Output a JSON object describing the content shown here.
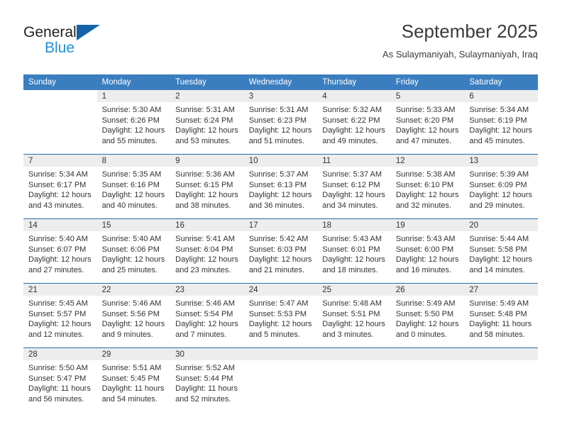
{
  "brand": {
    "line1": "General",
    "line2": "Blue",
    "triangle_color": "#1463a8",
    "blue_text_color": "#1f8fd6"
  },
  "header": {
    "title": "September 2025",
    "subtitle": "As Sulaymaniyah, Sulaymaniyah, Iraq"
  },
  "colors": {
    "header_row_bg": "#3a7ebf",
    "day_band_bg": "#ededed",
    "row_divider": "#2a6ca8",
    "text": "#333333"
  },
  "weekdays": [
    "Sunday",
    "Monday",
    "Tuesday",
    "Wednesday",
    "Thursday",
    "Friday",
    "Saturday"
  ],
  "labels": {
    "sunrise_prefix": "Sunrise:",
    "sunset_prefix": "Sunset:",
    "daylight_prefix": "Daylight:"
  },
  "weeks": [
    [
      {
        "day": "",
        "blank": true,
        "l1": "",
        "l2": "",
        "l3": "",
        "l4": ""
      },
      {
        "day": "1",
        "l1": "Sunrise: 5:30 AM",
        "l2": "Sunset: 6:26 PM",
        "l3": "Daylight: 12 hours",
        "l4": "and 55 minutes."
      },
      {
        "day": "2",
        "l1": "Sunrise: 5:31 AM",
        "l2": "Sunset: 6:24 PM",
        "l3": "Daylight: 12 hours",
        "l4": "and 53 minutes."
      },
      {
        "day": "3",
        "l1": "Sunrise: 5:31 AM",
        "l2": "Sunset: 6:23 PM",
        "l3": "Daylight: 12 hours",
        "l4": "and 51 minutes."
      },
      {
        "day": "4",
        "l1": "Sunrise: 5:32 AM",
        "l2": "Sunset: 6:22 PM",
        "l3": "Daylight: 12 hours",
        "l4": "and 49 minutes."
      },
      {
        "day": "5",
        "l1": "Sunrise: 5:33 AM",
        "l2": "Sunset: 6:20 PM",
        "l3": "Daylight: 12 hours",
        "l4": "and 47 minutes."
      },
      {
        "day": "6",
        "l1": "Sunrise: 5:34 AM",
        "l2": "Sunset: 6:19 PM",
        "l3": "Daylight: 12 hours",
        "l4": "and 45 minutes."
      }
    ],
    [
      {
        "day": "7",
        "l1": "Sunrise: 5:34 AM",
        "l2": "Sunset: 6:17 PM",
        "l3": "Daylight: 12 hours",
        "l4": "and 43 minutes."
      },
      {
        "day": "8",
        "l1": "Sunrise: 5:35 AM",
        "l2": "Sunset: 6:16 PM",
        "l3": "Daylight: 12 hours",
        "l4": "and 40 minutes."
      },
      {
        "day": "9",
        "l1": "Sunrise: 5:36 AM",
        "l2": "Sunset: 6:15 PM",
        "l3": "Daylight: 12 hours",
        "l4": "and 38 minutes."
      },
      {
        "day": "10",
        "l1": "Sunrise: 5:37 AM",
        "l2": "Sunset: 6:13 PM",
        "l3": "Daylight: 12 hours",
        "l4": "and 36 minutes."
      },
      {
        "day": "11",
        "l1": "Sunrise: 5:37 AM",
        "l2": "Sunset: 6:12 PM",
        "l3": "Daylight: 12 hours",
        "l4": "and 34 minutes."
      },
      {
        "day": "12",
        "l1": "Sunrise: 5:38 AM",
        "l2": "Sunset: 6:10 PM",
        "l3": "Daylight: 12 hours",
        "l4": "and 32 minutes."
      },
      {
        "day": "13",
        "l1": "Sunrise: 5:39 AM",
        "l2": "Sunset: 6:09 PM",
        "l3": "Daylight: 12 hours",
        "l4": "and 29 minutes."
      }
    ],
    [
      {
        "day": "14",
        "l1": "Sunrise: 5:40 AM",
        "l2": "Sunset: 6:07 PM",
        "l3": "Daylight: 12 hours",
        "l4": "and 27 minutes."
      },
      {
        "day": "15",
        "l1": "Sunrise: 5:40 AM",
        "l2": "Sunset: 6:06 PM",
        "l3": "Daylight: 12 hours",
        "l4": "and 25 minutes."
      },
      {
        "day": "16",
        "l1": "Sunrise: 5:41 AM",
        "l2": "Sunset: 6:04 PM",
        "l3": "Daylight: 12 hours",
        "l4": "and 23 minutes."
      },
      {
        "day": "17",
        "l1": "Sunrise: 5:42 AM",
        "l2": "Sunset: 6:03 PM",
        "l3": "Daylight: 12 hours",
        "l4": "and 21 minutes."
      },
      {
        "day": "18",
        "l1": "Sunrise: 5:43 AM",
        "l2": "Sunset: 6:01 PM",
        "l3": "Daylight: 12 hours",
        "l4": "and 18 minutes."
      },
      {
        "day": "19",
        "l1": "Sunrise: 5:43 AM",
        "l2": "Sunset: 6:00 PM",
        "l3": "Daylight: 12 hours",
        "l4": "and 16 minutes."
      },
      {
        "day": "20",
        "l1": "Sunrise: 5:44 AM",
        "l2": "Sunset: 5:58 PM",
        "l3": "Daylight: 12 hours",
        "l4": "and 14 minutes."
      }
    ],
    [
      {
        "day": "21",
        "l1": "Sunrise: 5:45 AM",
        "l2": "Sunset: 5:57 PM",
        "l3": "Daylight: 12 hours",
        "l4": "and 12 minutes."
      },
      {
        "day": "22",
        "l1": "Sunrise: 5:46 AM",
        "l2": "Sunset: 5:56 PM",
        "l3": "Daylight: 12 hours",
        "l4": "and 9 minutes."
      },
      {
        "day": "23",
        "l1": "Sunrise: 5:46 AM",
        "l2": "Sunset: 5:54 PM",
        "l3": "Daylight: 12 hours",
        "l4": "and 7 minutes."
      },
      {
        "day": "24",
        "l1": "Sunrise: 5:47 AM",
        "l2": "Sunset: 5:53 PM",
        "l3": "Daylight: 12 hours",
        "l4": "and 5 minutes."
      },
      {
        "day": "25",
        "l1": "Sunrise: 5:48 AM",
        "l2": "Sunset: 5:51 PM",
        "l3": "Daylight: 12 hours",
        "l4": "and 3 minutes."
      },
      {
        "day": "26",
        "l1": "Sunrise: 5:49 AM",
        "l2": "Sunset: 5:50 PM",
        "l3": "Daylight: 12 hours",
        "l4": "and 0 minutes."
      },
      {
        "day": "27",
        "l1": "Sunrise: 5:49 AM",
        "l2": "Sunset: 5:48 PM",
        "l3": "Daylight: 11 hours",
        "l4": "and 58 minutes."
      }
    ],
    [
      {
        "day": "28",
        "l1": "Sunrise: 5:50 AM",
        "l2": "Sunset: 5:47 PM",
        "l3": "Daylight: 11 hours",
        "l4": "and 56 minutes."
      },
      {
        "day": "29",
        "l1": "Sunrise: 5:51 AM",
        "l2": "Sunset: 5:45 PM",
        "l3": "Daylight: 11 hours",
        "l4": "and 54 minutes."
      },
      {
        "day": "30",
        "l1": "Sunrise: 5:52 AM",
        "l2": "Sunset: 5:44 PM",
        "l3": "Daylight: 11 hours",
        "l4": "and 52 minutes."
      },
      {
        "day": "",
        "empty": true,
        "l1": "",
        "l2": "",
        "l3": "",
        "l4": ""
      },
      {
        "day": "",
        "empty": true,
        "l1": "",
        "l2": "",
        "l3": "",
        "l4": ""
      },
      {
        "day": "",
        "empty": true,
        "l1": "",
        "l2": "",
        "l3": "",
        "l4": ""
      },
      {
        "day": "",
        "empty": true,
        "l1": "",
        "l2": "",
        "l3": "",
        "l4": ""
      }
    ]
  ]
}
